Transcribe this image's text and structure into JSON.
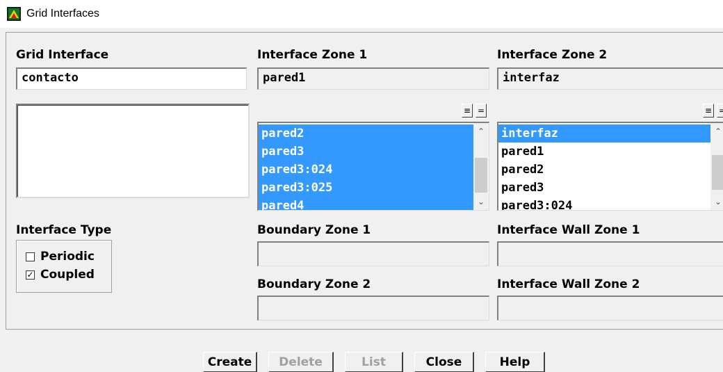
{
  "window": {
    "title": "Grid Interfaces"
  },
  "grid_interface": {
    "label": "Grid Interface",
    "value": "contacto"
  },
  "zone1": {
    "label": "Interface Zone 1",
    "value": "pared1",
    "list_items": [
      "pared2",
      "pared3",
      "pared3:024",
      "pared3:025",
      "pared4"
    ],
    "selected_all": true
  },
  "zone2": {
    "label": "Interface Zone 2",
    "value": "interfaz",
    "list_items": [
      "interfaz",
      "pared1",
      "pared2",
      "pared3",
      "pared3:024"
    ],
    "selected_index": 0
  },
  "mini_buttons": {
    "select_all": "≡",
    "deselect_all": "="
  },
  "interface_type": {
    "label": "Interface Type",
    "options": [
      {
        "label": "Periodic",
        "checked": false,
        "mark": ""
      },
      {
        "label": "Coupled",
        "checked": true,
        "mark": "✓"
      }
    ]
  },
  "boundary_zone_1": {
    "label": "Boundary Zone 1",
    "value": ""
  },
  "boundary_zone_2": {
    "label": "Boundary Zone 2",
    "value": ""
  },
  "interface_wall_zone_1": {
    "label": "Interface Wall Zone 1",
    "value": ""
  },
  "interface_wall_zone_2": {
    "label": "Interface Wall Zone 2",
    "value": ""
  },
  "buttons": {
    "create": "Create",
    "delete": "Delete",
    "list": "List",
    "close": "Close",
    "help": "Help"
  },
  "colors": {
    "selection": "#3399ff",
    "background": "#f0f0f0"
  }
}
